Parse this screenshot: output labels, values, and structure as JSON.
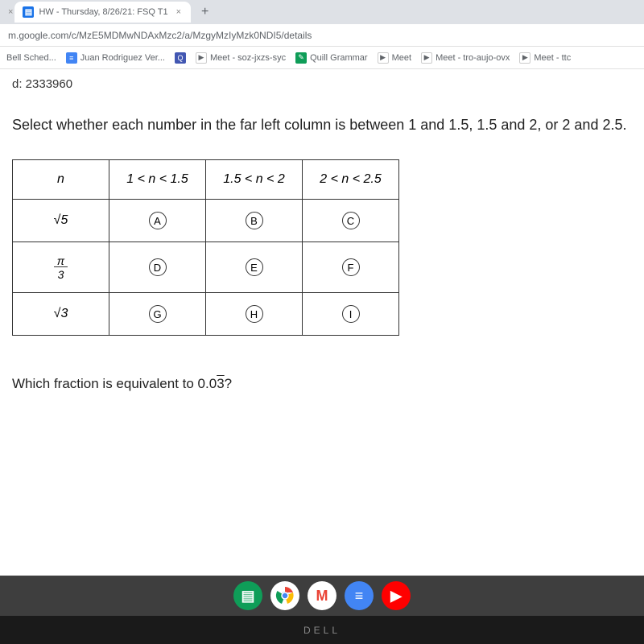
{
  "browser": {
    "tab_close_prev": "×",
    "tab_title": "HW - Thursday, 8/26/21: FSQ T1",
    "tab_close": "×",
    "new_tab": "+",
    "url": "m.google.com/c/MzE5MDMwNDAxMzc2/a/MzgyMzIyMzk0NDI5/details"
  },
  "bookmarks": {
    "items": [
      {
        "label": "Bell Sched..."
      },
      {
        "label": "Juan Rodriguez Ver..."
      },
      {
        "label": ""
      },
      {
        "label": "Meet - soz-jxzs-syc"
      },
      {
        "label": "Quill Grammar"
      },
      {
        "label": "Meet"
      },
      {
        "label": "Meet - tro-aujo-ovx"
      },
      {
        "label": "Meet - ttc"
      }
    ]
  },
  "doc": {
    "id_label": "d:  2333960",
    "question1": "Select whether each number in the far left column is between 1 and 1.5, 1.5 and 2, or 2 and 2.5.",
    "question2_prefix": "Which fraction is equivalent to 0.0",
    "question2_repeating": "3",
    "question2_suffix": "?"
  },
  "table": {
    "headers": {
      "n": "n",
      "c1": "1 < n < 1.5",
      "c2": "1.5 < n < 2",
      "c3": "2 < n < 2.5"
    },
    "rows": [
      {
        "label_sqrt": "5",
        "a": "A",
        "b": "B",
        "c": "C"
      },
      {
        "frac_num": "π",
        "frac_den": "3",
        "a": "D",
        "b": "E",
        "c": "F"
      },
      {
        "label_sqrt": "3",
        "a": "G",
        "b": "H",
        "c": "I"
      }
    ]
  },
  "taskbar": {
    "dell": "DELL"
  },
  "colors": {
    "chrome": "#4285f4",
    "gmail": "#ea4335",
    "docs": "#4285f4",
    "youtube": "#ff0000",
    "green_app": "#0f9d58"
  }
}
